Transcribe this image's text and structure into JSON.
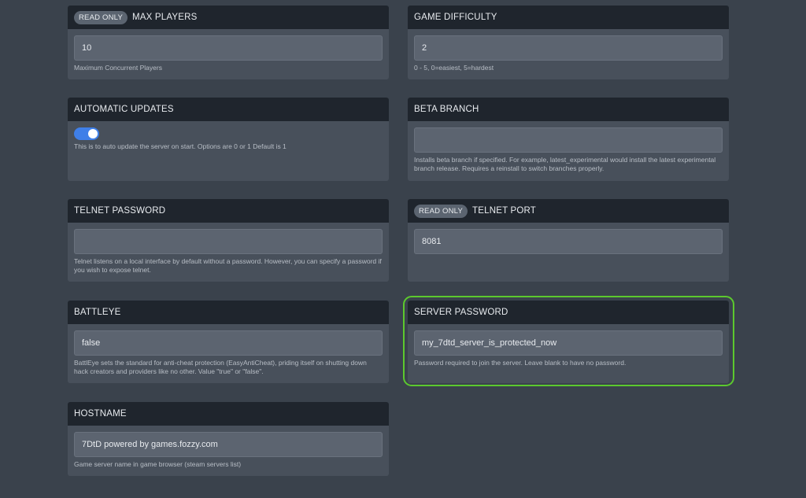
{
  "cards": {
    "max_players": {
      "badge": "READ ONLY",
      "title": "MAX PLAYERS",
      "value": "10",
      "help": "Maximum Concurrent Players"
    },
    "game_difficulty": {
      "title": "GAME DIFFICULTY",
      "value": "2",
      "help": "0 - 5, 0=easiest, 5=hardest"
    },
    "automatic_updates": {
      "title": "AUTOMATIC UPDATES",
      "toggle_on": true,
      "help": "This is to auto update the server on start. Options are 0 or 1 Default is 1"
    },
    "beta_branch": {
      "title": "BETA BRANCH",
      "value": "",
      "help": "Installs beta branch if specified. For example, latest_experimental would install the latest experimental branch release. Requires a reinstall to switch branches properly."
    },
    "telnet_password": {
      "title": "TELNET PASSWORD",
      "value": "",
      "help": "Telnet listens on a local interface by default without a password. However, you can specify a password if you wish to expose telnet."
    },
    "telnet_port": {
      "badge": "READ ONLY",
      "title": "TELNET PORT",
      "value": "8081"
    },
    "battleye": {
      "title": "BATTLEYE",
      "value": "false",
      "help": "BattlEye sets the standard for anti-cheat protection (EasyAntiCheat), priding itself on shutting down hack creators and providers like no other. Value \"true\" or \"false\"."
    },
    "server_password": {
      "title": "SERVER PASSWORD",
      "value": "my_7dtd_server_is_protected_now",
      "help": "Password required to join the server. Leave blank to have no password."
    },
    "hostname": {
      "title": "HOSTNAME",
      "value": "7DtD powered by games.fozzy.com",
      "help": "Game server name in game browser (steam servers list)"
    }
  },
  "colors": {
    "background": "#3a424c",
    "card": "#48505b",
    "header": "#1f252d",
    "toggle_on": "#3f7fe8",
    "highlight": "#5cc92e"
  }
}
